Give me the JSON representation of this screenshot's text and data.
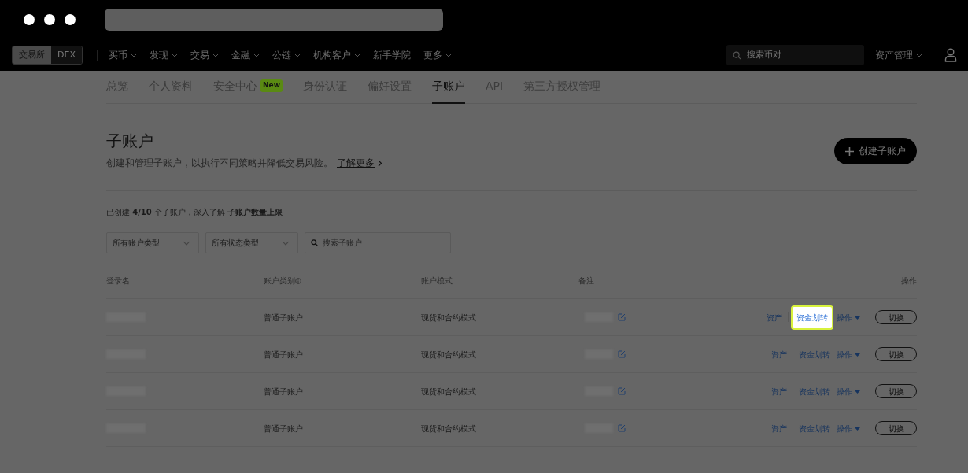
{
  "nav": {
    "mode_toggle": [
      {
        "label": "交易所",
        "selected": true
      },
      {
        "label": "DEX",
        "selected": false
      }
    ],
    "menu": [
      {
        "label": "买币",
        "dropdown": true
      },
      {
        "label": "发现",
        "dropdown": true
      },
      {
        "label": "交易",
        "dropdown": true
      },
      {
        "label": "金融",
        "dropdown": true
      },
      {
        "label": "公链",
        "dropdown": true
      },
      {
        "label": "机构客户",
        "dropdown": true
      },
      {
        "label": "新手学院",
        "dropdown": false
      },
      {
        "label": "更多",
        "dropdown": true
      }
    ],
    "search": {
      "placeholder": "搜索币对"
    },
    "asset_menu": "资产管理"
  },
  "tabs": [
    {
      "label": "总览",
      "selected": false
    },
    {
      "label": "个人资料",
      "selected": false
    },
    {
      "label": "安全中心",
      "selected": false,
      "badge": "New"
    },
    {
      "label": "身份认证",
      "selected": false
    },
    {
      "label": "偏好设置",
      "selected": false
    },
    {
      "label": "子账户",
      "selected": true
    },
    {
      "label": "API",
      "selected": false
    },
    {
      "label": "第三方授权管理",
      "selected": false
    }
  ],
  "header": {
    "title": "子账户",
    "description": "创建和管理子账户，以执行不同策略并降低交易风险。",
    "learn_more": "了解更多",
    "create_button": "创建子账户"
  },
  "summary": {
    "text": "已创建 **4/10** 个子账户，深入了解",
    "link": "子账户数量上限"
  },
  "filters": {
    "selects": [
      "所有账户类型",
      "所有状态类型"
    ],
    "search_placeholder": "搜索子账户"
  },
  "table": {
    "columns": [
      {
        "label": "登录名",
        "info": false
      },
      {
        "label": "账户类别",
        "info": true
      },
      {
        "label": "账户模式",
        "info": false
      },
      {
        "label": "备注",
        "info": false
      },
      {
        "label": "操作",
        "info": false
      }
    ],
    "rows": [
      {
        "category": "普通子账户",
        "mode": "现货和合约模式",
        "actions": {
          "assets": "资产",
          "transfer": "资金划转",
          "transfer_highlighted": true,
          "operations": "操作",
          "switch": "切换"
        }
      },
      {
        "category": "普通子账户",
        "mode": "现货和合约模式",
        "actions": {
          "assets": "资产",
          "transfer": "资金划转",
          "transfer_highlighted": false,
          "operations": "操作",
          "switch": "切换"
        }
      },
      {
        "category": "普通子账户",
        "mode": "现货和合约模式",
        "actions": {
          "assets": "资产",
          "transfer": "资金划转",
          "transfer_highlighted": false,
          "operations": "操作",
          "switch": "切换"
        }
      },
      {
        "category": "普通子账户",
        "mode": "现货和合约模式",
        "actions": {
          "assets": "资产",
          "transfer": "资金划转",
          "transfer_highlighted": false,
          "operations": "操作",
          "switch": "切换"
        }
      }
    ]
  }
}
